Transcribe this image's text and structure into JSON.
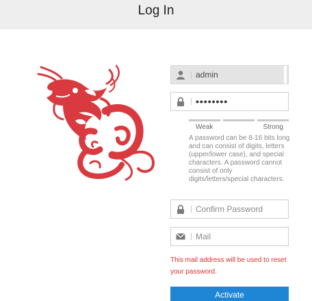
{
  "header": {
    "title": "Log In"
  },
  "form": {
    "username": {
      "value": "admin"
    },
    "password": {
      "value": "••••••••"
    },
    "strength": {
      "weak_label": "Weak",
      "strong_label": "Strong"
    },
    "hint": "A password can be 8-16 bits long and can consist of digits, letters (upper/lower case), and special characters. A password cannot consist of only digits/letters/special characters.",
    "confirm": {
      "placeholder": "Confirm Password"
    },
    "mail": {
      "placeholder": "Mail"
    },
    "notice": "This mail address will be used to reset your password.",
    "activate_label": "Activate"
  },
  "icons": {
    "user": "user-icon",
    "lock": "lock-icon",
    "mail": "mail-icon",
    "logo": "dragon-logo"
  },
  "colors": {
    "accent": "#1f86d6",
    "warning": "#d9302c",
    "logo": "#d83a3f"
  }
}
